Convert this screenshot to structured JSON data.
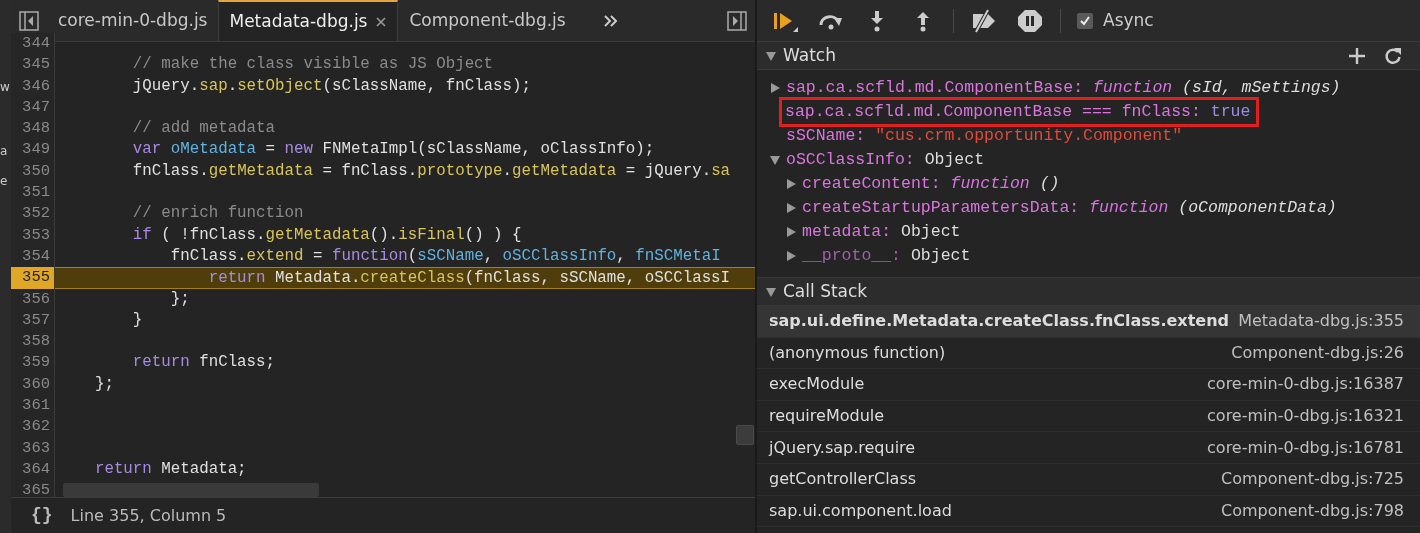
{
  "side_fragments": [
    "w",
    "a",
    "e"
  ],
  "tabs": [
    {
      "label": "core-min-0-dbg.js",
      "selected": false
    },
    {
      "label": "Metadata-dbg.js",
      "selected": true
    },
    {
      "label": "Component-dbg.js",
      "selected": false
    }
  ],
  "editor": {
    "lines": [
      {
        "number": "344",
        "current": false
      },
      {
        "number": "345",
        "current": false,
        "tokens": [
          {
            "kind": "comment",
            "text": "        // make the class visible as JS Object"
          }
        ]
      },
      {
        "number": "346",
        "current": false,
        "tokens": [
          {
            "kind": "plain",
            "text": "        jQuery."
          },
          {
            "kind": "prop",
            "text": "sap"
          },
          {
            "kind": "plain",
            "text": "."
          },
          {
            "kind": "prop",
            "text": "setObject"
          },
          {
            "kind": "plain",
            "text": "(sClassName, fnClass);"
          }
        ]
      },
      {
        "number": "347",
        "current": false
      },
      {
        "number": "348",
        "current": false,
        "tokens": [
          {
            "kind": "comment",
            "text": "        // add metadata"
          }
        ]
      },
      {
        "number": "349",
        "current": false,
        "tokens": [
          {
            "kind": "keyword",
            "text": "        var "
          },
          {
            "kind": "variable",
            "text": "oMetadata"
          },
          {
            "kind": "plain",
            "text": " = "
          },
          {
            "kind": "keyword",
            "text": "new"
          },
          {
            "kind": "plain",
            "text": " FNMetaImpl(sClassName, oClassInfo);"
          }
        ]
      },
      {
        "number": "350",
        "current": false,
        "tokens": [
          {
            "kind": "plain",
            "text": "        fnClass."
          },
          {
            "kind": "prop",
            "text": "getMetadata"
          },
          {
            "kind": "plain",
            "text": " = fnClass."
          },
          {
            "kind": "prop",
            "text": "prototype"
          },
          {
            "kind": "plain",
            "text": "."
          },
          {
            "kind": "prop",
            "text": "getMetadata"
          },
          {
            "kind": "plain",
            "text": " = jQuery."
          },
          {
            "kind": "prop",
            "text": "sa"
          }
        ]
      },
      {
        "number": "351",
        "current": false
      },
      {
        "number": "352",
        "current": false,
        "tokens": [
          {
            "kind": "comment",
            "text": "        // enrich function"
          }
        ]
      },
      {
        "number": "353",
        "current": false,
        "tokens": [
          {
            "kind": "keyword",
            "text": "        if"
          },
          {
            "kind": "plain",
            "text": " ( !fnClass."
          },
          {
            "kind": "prop",
            "text": "getMetadata"
          },
          {
            "kind": "plain",
            "text": "()."
          },
          {
            "kind": "prop",
            "text": "isFinal"
          },
          {
            "kind": "plain",
            "text": "() ) {"
          }
        ]
      },
      {
        "number": "354",
        "current": false,
        "tokens": [
          {
            "kind": "plain",
            "text": "            fnClass."
          },
          {
            "kind": "prop",
            "text": "extend"
          },
          {
            "kind": "plain",
            "text": " = "
          },
          {
            "kind": "keyword",
            "text": "function"
          },
          {
            "kind": "plain",
            "text": "("
          },
          {
            "kind": "variable",
            "text": "sSCName"
          },
          {
            "kind": "plain",
            "text": ", "
          },
          {
            "kind": "variable",
            "text": "oSCClassInfo"
          },
          {
            "kind": "plain",
            "text": ", "
          },
          {
            "kind": "variable",
            "text": "fnSCMetaI"
          }
        ]
      },
      {
        "number": "355",
        "current": true,
        "tokens": [
          {
            "kind": "keyword",
            "text": "                return"
          },
          {
            "kind": "plain",
            "text": " Metadata."
          },
          {
            "kind": "prop",
            "text": "createClass"
          },
          {
            "kind": "plain",
            "text": "(fnClass, sSCName, oSCClassI"
          }
        ]
      },
      {
        "number": "356",
        "current": false,
        "tokens": [
          {
            "kind": "plain",
            "text": "            };"
          }
        ]
      },
      {
        "number": "357",
        "current": false,
        "tokens": [
          {
            "kind": "plain",
            "text": "        }"
          }
        ]
      },
      {
        "number": "358",
        "current": false
      },
      {
        "number": "359",
        "current": false,
        "tokens": [
          {
            "kind": "keyword",
            "text": "        return"
          },
          {
            "kind": "plain",
            "text": " fnClass;"
          }
        ]
      },
      {
        "number": "360",
        "current": false,
        "tokens": [
          {
            "kind": "plain",
            "text": "    };"
          }
        ]
      },
      {
        "number": "361",
        "current": false
      },
      {
        "number": "362",
        "current": false
      },
      {
        "number": "363",
        "current": false
      },
      {
        "number": "364",
        "current": false,
        "tokens": [
          {
            "kind": "keyword",
            "text": "    return"
          },
          {
            "kind": "plain",
            "text": " Metadata;"
          }
        ]
      },
      {
        "number": "365",
        "current": false
      }
    ]
  },
  "status_bar": {
    "format_button": "{}",
    "position": "Line 355, Column 5"
  },
  "debugger_toolbar": {
    "async": {
      "label": "Async",
      "checked": true
    }
  },
  "watch": {
    "title": "Watch",
    "expanded": true,
    "items": [
      {
        "key": "sap.ca.scfld.md.ComponentBase:",
        "kind": "function",
        "value": "function",
        "signature": "(sId, mSettings)",
        "expanded": false,
        "outlined": false
      },
      {
        "key": "sap.ca.scfld.md.ComponentBase === fnClass:",
        "kind": "boolean",
        "value": "true",
        "outlined": true
      },
      {
        "key": "sSCName:",
        "kind": "string",
        "value": "\"cus.crm.opportunity.Component\"",
        "outlined": false
      },
      {
        "key": "oSCClassInfo:",
        "kind": "object",
        "value": "Object",
        "expanded": true,
        "outlined": false,
        "children": [
          {
            "key": "createContent:",
            "kind": "function",
            "value": "function",
            "signature": "()",
            "expanded": false,
            "dim": false
          },
          {
            "key": "createStartupParametersData:",
            "kind": "function",
            "value": "function",
            "signature": "(oComponentData)",
            "expanded": false,
            "dim": false
          },
          {
            "key": "metadata:",
            "kind": "object",
            "value": "Object",
            "expanded": false,
            "dim": false
          },
          {
            "key": "__proto__:",
            "kind": "object",
            "value": "Object",
            "expanded": false,
            "dim": true
          }
        ]
      }
    ]
  },
  "call_stack": {
    "title": "Call Stack",
    "expanded": true,
    "frames": [
      {
        "function": "sap.ui.define.Metadata.createClass.fnClass.extend",
        "location": "Metadata-dbg.js:355",
        "selected": true
      },
      {
        "function": "(anonymous function)",
        "location": "Component-dbg.js:26",
        "selected": false
      },
      {
        "function": "execModule",
        "location": "core-min-0-dbg.js:16387",
        "selected": false
      },
      {
        "function": "requireModule",
        "location": "core-min-0-dbg.js:16321",
        "selected": false
      },
      {
        "function": "jQuery.sap.require",
        "location": "core-min-0-dbg.js:16781",
        "selected": false
      },
      {
        "function": "getControllerClass",
        "location": "Component-dbg.js:725",
        "selected": false
      },
      {
        "function": "sap.ui.component.load",
        "location": "Component-dbg.js:798",
        "selected": false
      }
    ]
  }
}
